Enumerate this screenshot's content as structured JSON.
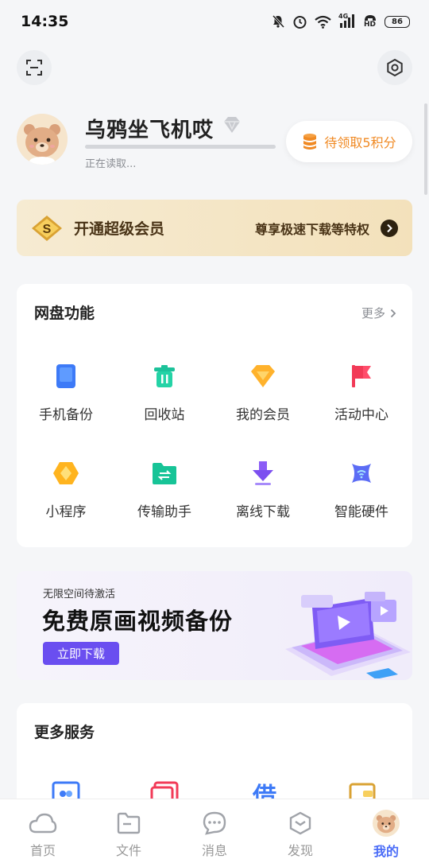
{
  "status_bar": {
    "time": "14:35",
    "network": "4G",
    "hd": "HD",
    "battery": "86"
  },
  "profile": {
    "username": "乌鸦坐飞机哎",
    "status": "正在读取...",
    "points_label": "待领取5积分"
  },
  "vip": {
    "title": "开通超级会员",
    "subtitle": "尊享极速下载等特权"
  },
  "features": {
    "title": "网盘功能",
    "more": "更多",
    "items": [
      {
        "label": "手机备份",
        "icon": "phone-backup-icon"
      },
      {
        "label": "回收站",
        "icon": "recycle-bin-icon"
      },
      {
        "label": "我的会员",
        "icon": "membership-icon"
      },
      {
        "label": "活动中心",
        "icon": "flag-icon"
      },
      {
        "label": "小程序",
        "icon": "mini-program-icon"
      },
      {
        "label": "传输助手",
        "icon": "transfer-folder-icon"
      },
      {
        "label": "离线下载",
        "icon": "download-arrow-icon"
      },
      {
        "label": "智能硬件",
        "icon": "smart-hardware-icon"
      }
    ]
  },
  "promo": {
    "subtitle": "无限空间待激活",
    "title": "免费原画视频备份",
    "button": "立即下载"
  },
  "services": {
    "title": "更多服务",
    "loan_char": "借"
  },
  "tabs": [
    {
      "label": "首页",
      "icon": "cloud-icon"
    },
    {
      "label": "文件",
      "icon": "folder-icon"
    },
    {
      "label": "消息",
      "icon": "message-icon"
    },
    {
      "label": "发现",
      "icon": "discover-icon"
    },
    {
      "label": "我的",
      "icon": "bear-avatar-icon",
      "active": true
    }
  ],
  "colors": {
    "accent": "#4a6cf7",
    "points": "#f08a24",
    "vip_text": "#4a3417",
    "promo_button": "#6a4ef0"
  }
}
